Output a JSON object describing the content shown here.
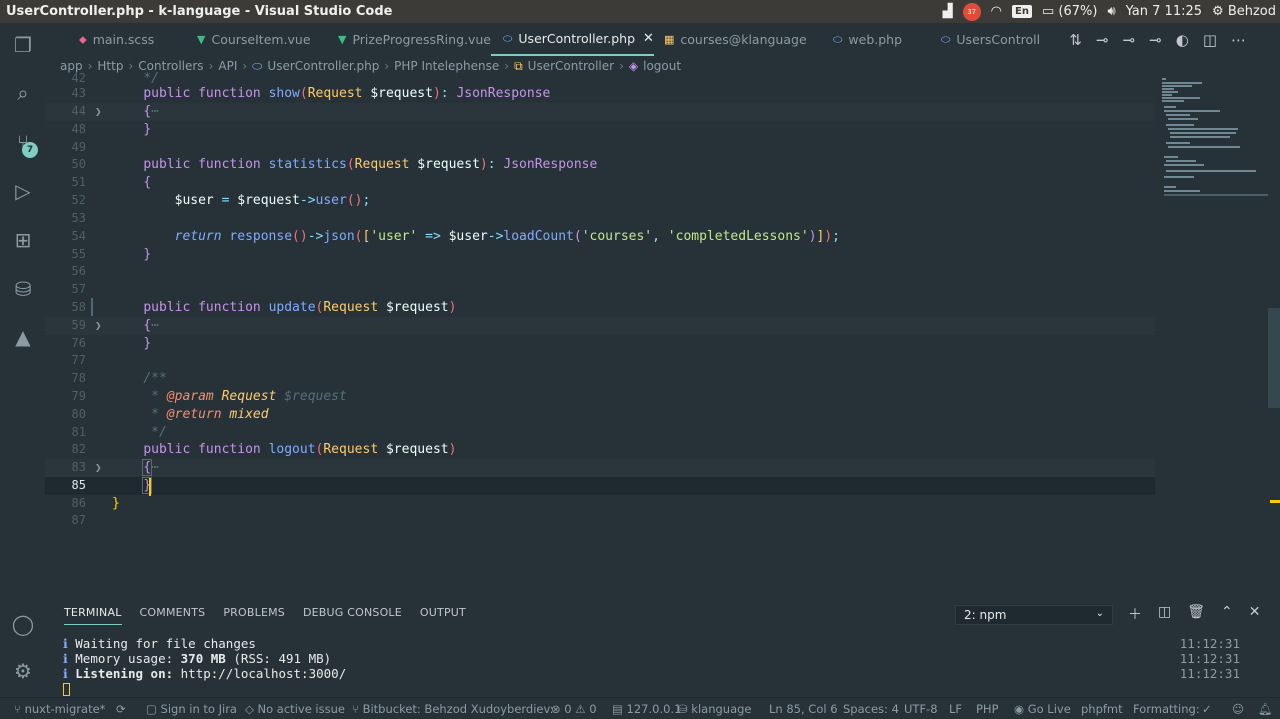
{
  "window": {
    "title": "UserController.php - k-language - Visual Studio Code"
  },
  "tray": {
    "notif_count": "37",
    "lang": "En",
    "battery": "(67%)",
    "datetime": "Yan 7 11:25",
    "user": "Behzod"
  },
  "activity": {
    "scm_badge": "7"
  },
  "tabs": [
    {
      "label": "main.scss",
      "icon": "sass-icon",
      "color": "#f06292"
    },
    {
      "label": "CourseItem.vue",
      "icon": "vue-icon",
      "color": "#42b883"
    },
    {
      "label": "PrizeProgressRing.vue",
      "icon": "vue-icon",
      "color": "#42b883"
    },
    {
      "label": "UserController.php",
      "icon": "php-icon",
      "color": "#82aaff",
      "active": true
    },
    {
      "label": "courses@klanguage",
      "icon": "table-icon",
      "color": "#ffcb6b"
    },
    {
      "label": "web.php",
      "icon": "php-icon",
      "color": "#82aaff"
    },
    {
      "label": "UsersControll",
      "icon": "php-icon",
      "color": "#82aaff"
    }
  ],
  "breadcrumbs": [
    "app",
    "Http",
    "Controllers",
    "API",
    "UserController.php",
    "PHP Intelephense",
    "UserController",
    "logout"
  ],
  "code": {
    "l42": "42",
    "l43": "43",
    "l44": "44",
    "l48": "48",
    "l49": "49",
    "l50": "50",
    "l51": "51",
    "l52": "52",
    "l53": "53",
    "l54": "54",
    "l55": "55",
    "l56": "56",
    "l57": "57",
    "l58": "58",
    "l59": "59",
    "l76": "76",
    "l77": "77",
    "l78": "78",
    "l79": "79",
    "l80": "80",
    "l81": "81",
    "l82": "82",
    "l83": "83",
    "l85": "85",
    "l86": "86",
    "l87": "87",
    "kw_public": "public",
    "kw_function": "function",
    "kw_return": "return",
    "fn_show": "show",
    "fn_statistics": "statistics",
    "fn_update": "update",
    "fn_logout": "logout",
    "cls_request": "Request",
    "cls_json": "JsonResponse",
    "var_request": "$request",
    "var_user": "$user",
    "user_method": "user",
    "response_fn": "response",
    "json_fn": "json",
    "loadcount_fn": "loadCount",
    "str_user": "'user'",
    "str_courses": "'courses'",
    "str_completed": "'completedLessons'",
    "doc_open": "/**",
    "doc_star": "*",
    "doc_close": "*/",
    "tag_param": "@param",
    "tag_return": "@return",
    "ty_mixed": "mixed",
    "ellipsis": "⋯"
  },
  "panel": {
    "tabs": [
      "TERMINAL",
      "COMMENTS",
      "PROBLEMS",
      "DEBUG CONSOLE",
      "OUTPUT"
    ],
    "selector": "2: npm",
    "lines": [
      {
        "icon": "ℹ",
        "label": "Waiting for file changes",
        "value": "",
        "rest": ""
      },
      {
        "icon": "ℹ",
        "label": "Memory usage: ",
        "value": "370 MB",
        "rest": " (RSS: 491 MB)"
      },
      {
        "icon": "ℹ",
        "label": "Listening on:",
        "value": "",
        "rest": " http://localhost:3000/"
      }
    ],
    "times": [
      "11:12:31",
      "11:12:31",
      "11:12:31"
    ]
  },
  "status": {
    "branch": "nuxt-migrate*",
    "jira": "Sign in to Jira",
    "issue": "No active issue",
    "bitbucket": "Bitbucket: Behzod Xudoyberdiev:",
    "errors": "0",
    "warnings": "0",
    "db": "127.0.0.1",
    "project": "klanguage",
    "position": "Ln 85, Col 6",
    "spaces": "Spaces: 4",
    "encoding": "UTF-8",
    "eol": "LF",
    "language": "PHP",
    "golive": "Go Live",
    "formatter": "phpfmt",
    "formatting": "Formatting:"
  }
}
